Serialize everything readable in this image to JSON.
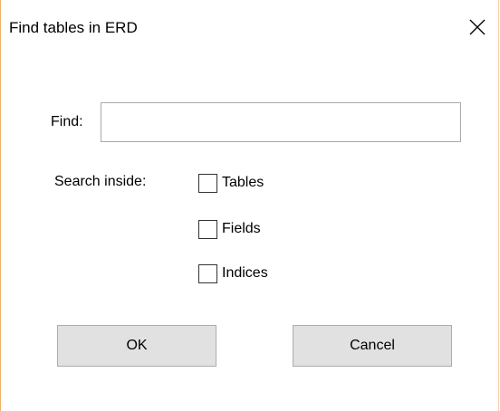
{
  "window": {
    "title": "Find tables in ERD"
  },
  "form": {
    "find_label": "Find:",
    "find_value": "",
    "find_placeholder": "",
    "search_inside_label": "Search inside:",
    "options": [
      {
        "label": "Tables",
        "checked": false
      },
      {
        "label": "Fields",
        "checked": false
      },
      {
        "label": "Indices",
        "checked": false
      }
    ]
  },
  "buttons": {
    "ok_label": "OK",
    "cancel_label": "Cancel"
  },
  "icons": {
    "close": "close-icon"
  },
  "colors": {
    "window_border": "#f0b36a",
    "button_face": "#e1e1e1",
    "button_border": "#adadad",
    "input_border": "#a9a9a9"
  }
}
